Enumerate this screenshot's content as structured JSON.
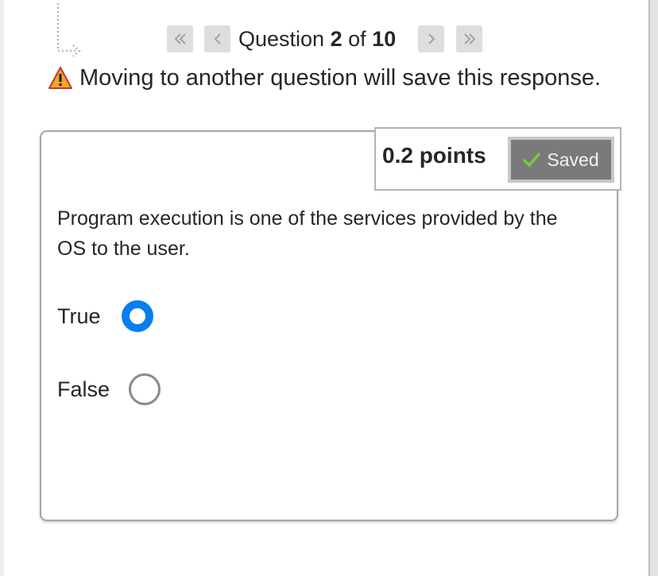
{
  "navigation": {
    "question_word": "Question",
    "current": "2",
    "of_word": "of",
    "total": "10"
  },
  "warning": {
    "text": "Moving to another question will save this response.",
    "icon": "warning-triangle-icon"
  },
  "question": {
    "points": "0.2 points",
    "saved_label": "Saved",
    "saved_icon": "check-icon",
    "prompt": "Program execution is one of the services provided by the OS to the user.",
    "options": [
      {
        "label": "True",
        "selected": true
      },
      {
        "label": "False",
        "selected": false
      }
    ]
  },
  "colors": {
    "accent": "#0a7ef0",
    "saved_badge": "#7a7a7a",
    "warning": "#f5a623"
  }
}
